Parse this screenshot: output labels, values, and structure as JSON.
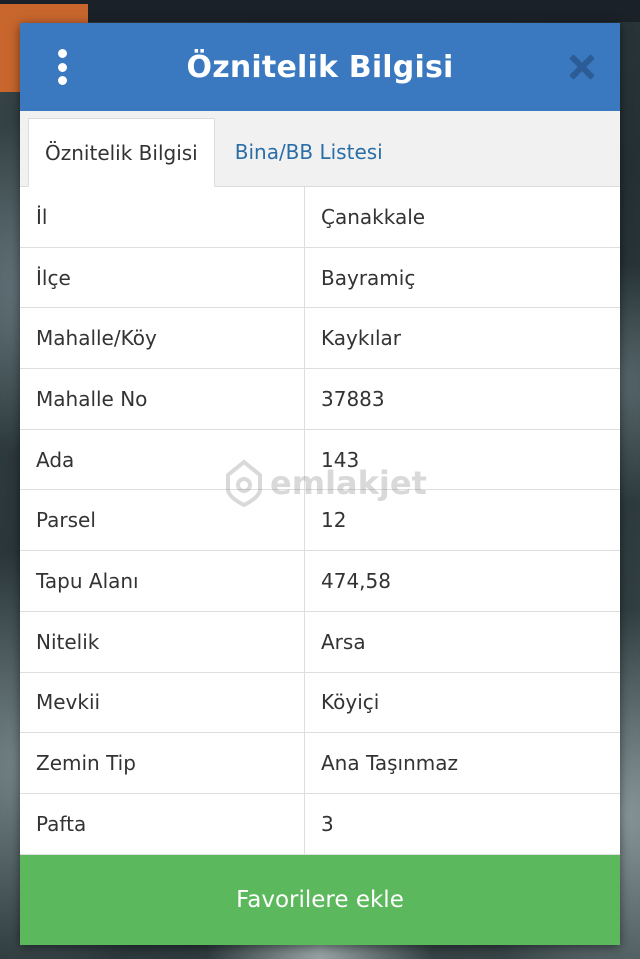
{
  "modal": {
    "title": "Öznitelik Bilgisi",
    "tabs": [
      {
        "label": "Öznitelik Bilgisi",
        "active": true
      },
      {
        "label": "Bina/BB Listesi",
        "active": false
      }
    ],
    "rows": [
      {
        "key": "İl",
        "value": "Çanakkale"
      },
      {
        "key": "İlçe",
        "value": "Bayramiç"
      },
      {
        "key": "Mahalle/Köy",
        "value": "Kaykılar"
      },
      {
        "key": "Mahalle No",
        "value": "37883"
      },
      {
        "key": "Ada",
        "value": "143"
      },
      {
        "key": "Parsel",
        "value": "12"
      },
      {
        "key": "Tapu Alanı",
        "value": "474,58"
      },
      {
        "key": "Nitelik",
        "value": "Arsa"
      },
      {
        "key": "Mevkii",
        "value": "Köyiçi"
      },
      {
        "key": "Zemin Tip",
        "value": "Ana Taşınmaz"
      },
      {
        "key": "Pafta",
        "value": "3"
      }
    ],
    "favorite_button": "Favorilere ekle"
  },
  "watermark": "emlakjet",
  "icons": {
    "menu": "kebab-menu-icon",
    "close": "close-icon",
    "watermark_logo": "location-pin-icon"
  },
  "colors": {
    "header": "#3a78bf",
    "tab_link": "#2a6ea8",
    "favorite_button": "#5cb85c",
    "close_icon": "#2b5c96"
  }
}
